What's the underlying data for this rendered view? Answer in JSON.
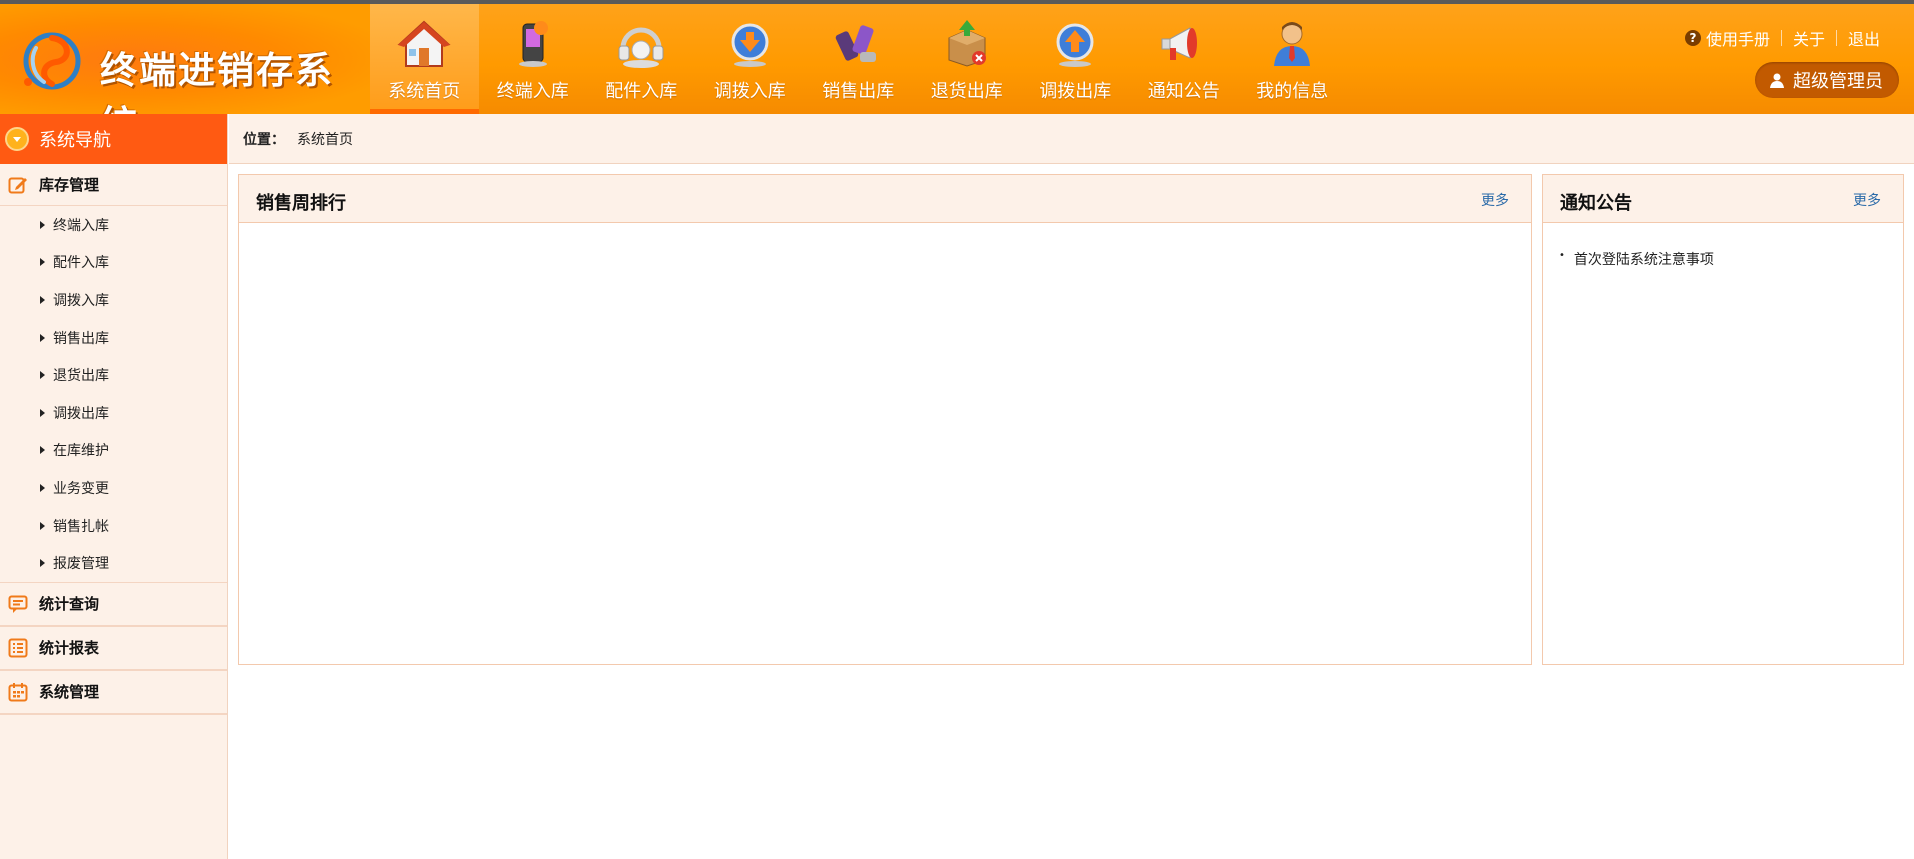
{
  "header": {
    "app_title": "终端进销存系统",
    "nav": [
      {
        "label": "系统首页",
        "icon": "home-icon",
        "active": true
      },
      {
        "label": "终端入库",
        "icon": "mobile-phone-icon",
        "active": false
      },
      {
        "label": "配件入库",
        "icon": "headset-icon",
        "active": false
      },
      {
        "label": "调拨入库",
        "icon": "transfer-in-icon",
        "active": false
      },
      {
        "label": "销售出库",
        "icon": "phones-sale-icon",
        "active": false
      },
      {
        "label": "退货出库",
        "icon": "return-box-icon",
        "active": false
      },
      {
        "label": "调拨出库",
        "icon": "transfer-out-icon",
        "active": false
      },
      {
        "label": "通知公告",
        "icon": "megaphone-icon",
        "active": false
      },
      {
        "label": "我的信息",
        "icon": "user-profile-icon",
        "active": false
      }
    ],
    "top_links": {
      "manual": "使用手册",
      "about": "关于",
      "logout": "退出"
    },
    "user_name": "超级管理员"
  },
  "sidebar": {
    "title": "系统导航",
    "groups": [
      {
        "label": "库存管理",
        "icon": "edit-icon",
        "expanded": true,
        "items": [
          "终端入库",
          "配件入库",
          "调拨入库",
          "销售出库",
          "退货出库",
          "调拨出库",
          "在库维护",
          "业务变更",
          "销售扎帐",
          "报废管理"
        ]
      },
      {
        "label": "统计查询",
        "icon": "chat-query-icon",
        "expanded": false
      },
      {
        "label": "统计报表",
        "icon": "list-report-icon",
        "expanded": false
      },
      {
        "label": "系统管理",
        "icon": "calendar-settings-icon",
        "expanded": false
      }
    ]
  },
  "breadcrumb": {
    "label": "位置：",
    "current": "系统首页"
  },
  "panels": {
    "sales": {
      "title": "销售周排行",
      "more": "更多"
    },
    "notice": {
      "title": "通知公告",
      "more": "更多",
      "items": [
        "首次登陆系统注意事项"
      ]
    }
  },
  "colors": {
    "header_orange": "#ff9a00",
    "sidebar_head": "#ff5a12",
    "panel_bg": "#fdf1e8",
    "link_blue": "#2a6aa8"
  }
}
